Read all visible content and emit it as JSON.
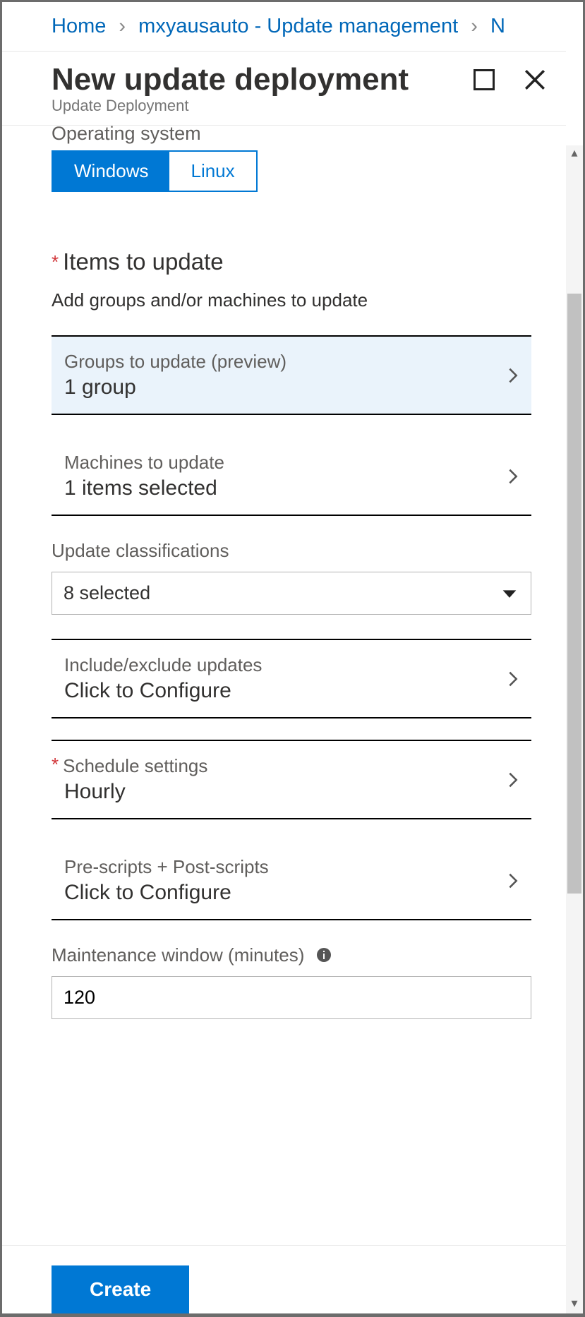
{
  "breadcrumb": {
    "home": "Home",
    "item": "mxyausauto - Update management",
    "trail": "N"
  },
  "header": {
    "title": "New update deployment",
    "subtitle": "Update Deployment"
  },
  "os": {
    "label": "Operating system",
    "windows": "Windows",
    "linux": "Linux"
  },
  "section": {
    "title": "Items to update",
    "help": "Add groups and/or machines to update"
  },
  "groups": {
    "label": "Groups to update (preview)",
    "value": "1 group"
  },
  "machines": {
    "label": "Machines to update",
    "value": "1 items selected"
  },
  "classifications": {
    "label": "Update classifications",
    "value": "8 selected"
  },
  "include": {
    "label": "Include/exclude updates",
    "value": "Click to Configure"
  },
  "schedule": {
    "label": "Schedule settings",
    "value": "Hourly"
  },
  "scripts": {
    "label": "Pre-scripts + Post-scripts",
    "value": "Click to Configure"
  },
  "maintenance": {
    "label": "Maintenance window (minutes)",
    "value": "120"
  },
  "footer": {
    "create": "Create"
  }
}
